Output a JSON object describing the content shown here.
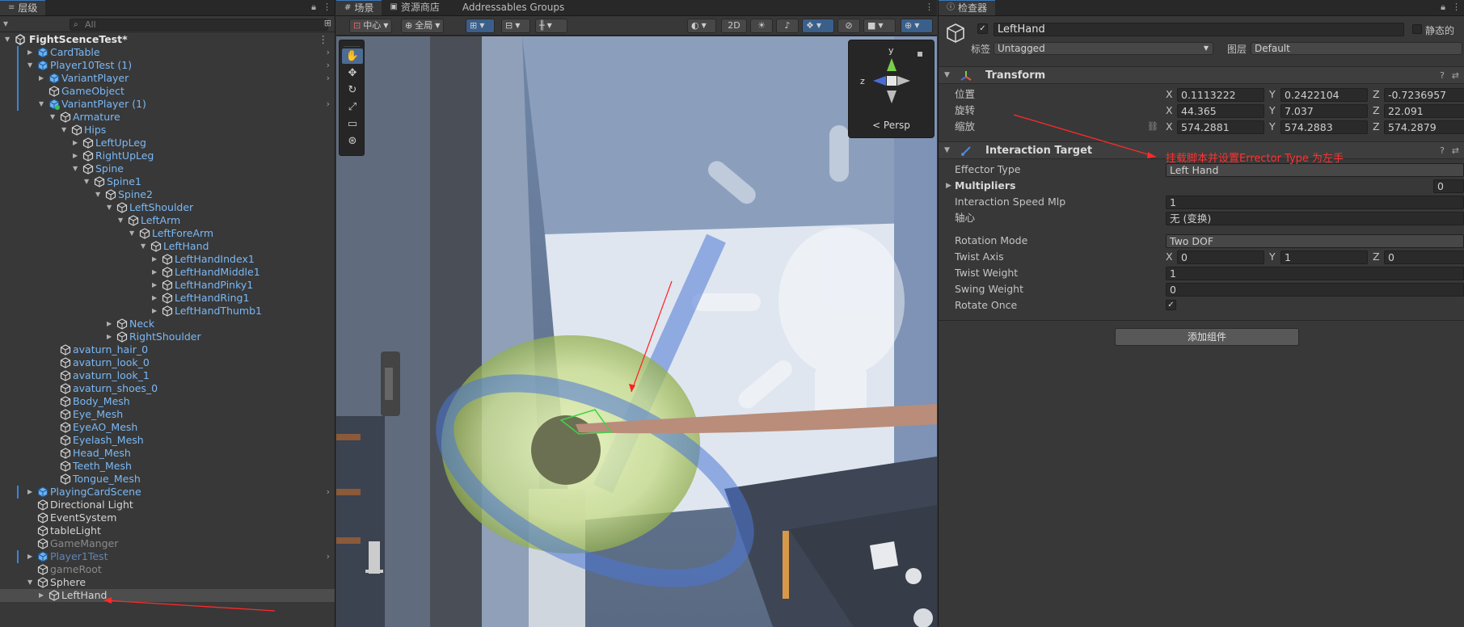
{
  "hierarchy": {
    "tab_label": "层级",
    "search_placeholder": "All",
    "scene_name": "FightScenceTest*",
    "rows": [
      {
        "label": "CardTable",
        "depth": 1,
        "exp": "right",
        "icon": "prefab",
        "color": "blue",
        "bar": true,
        "chev": true
      },
      {
        "label": "Player10Test (1)",
        "depth": 1,
        "exp": "down",
        "icon": "prefab",
        "color": "blue",
        "bar": true,
        "chev": true
      },
      {
        "label": "VariantPlayer",
        "depth": 2,
        "exp": "right",
        "icon": "prefab",
        "color": "blue",
        "bar": true,
        "chev": true
      },
      {
        "label": "GameObject",
        "depth": 2,
        "exp": "",
        "icon": "cube",
        "color": "blue",
        "bar": true
      },
      {
        "label": "VariantPlayer (1)",
        "depth": 2,
        "exp": "down",
        "icon": "variant",
        "color": "blue",
        "bar": true,
        "chev": true
      },
      {
        "label": "Armature",
        "depth": 3,
        "exp": "down",
        "icon": "cube",
        "color": "blue"
      },
      {
        "label": "Hips",
        "depth": 4,
        "exp": "down",
        "icon": "cube",
        "color": "blue"
      },
      {
        "label": "LeftUpLeg",
        "depth": 5,
        "exp": "right",
        "icon": "cube",
        "color": "blue"
      },
      {
        "label": "RightUpLeg",
        "depth": 5,
        "exp": "right",
        "icon": "cube",
        "color": "blue"
      },
      {
        "label": "Spine",
        "depth": 5,
        "exp": "down",
        "icon": "cube",
        "color": "blue"
      },
      {
        "label": "Spine1",
        "depth": 6,
        "exp": "down",
        "icon": "cube",
        "color": "blue"
      },
      {
        "label": "Spine2",
        "depth": 7,
        "exp": "down",
        "icon": "cube",
        "color": "blue"
      },
      {
        "label": "LeftShoulder",
        "depth": 8,
        "exp": "down",
        "icon": "cube",
        "color": "blue"
      },
      {
        "label": "LeftArm",
        "depth": 9,
        "exp": "down",
        "icon": "cube",
        "color": "blue"
      },
      {
        "label": "LeftForeArm",
        "depth": 10,
        "exp": "down",
        "icon": "cube",
        "color": "blue"
      },
      {
        "label": "LeftHand",
        "depth": 11,
        "exp": "down",
        "icon": "cube",
        "color": "blue"
      },
      {
        "label": "LeftHandIndex1",
        "depth": 12,
        "exp": "right",
        "icon": "cube",
        "color": "blue"
      },
      {
        "label": "LeftHandMiddle1",
        "depth": 12,
        "exp": "right",
        "icon": "cube",
        "color": "blue"
      },
      {
        "label": "LeftHandPinky1",
        "depth": 12,
        "exp": "right",
        "icon": "cube",
        "color": "blue"
      },
      {
        "label": "LeftHandRing1",
        "depth": 12,
        "exp": "right",
        "icon": "cube",
        "color": "blue"
      },
      {
        "label": "LeftHandThumb1",
        "depth": 12,
        "exp": "right",
        "icon": "cube",
        "color": "blue"
      },
      {
        "label": "Neck",
        "depth": 8,
        "exp": "right",
        "icon": "cube",
        "color": "blue"
      },
      {
        "label": "RightShoulder",
        "depth": 8,
        "exp": "right",
        "icon": "cube",
        "color": "blue"
      },
      {
        "label": "avaturn_hair_0",
        "depth": 3,
        "exp": "",
        "icon": "cube",
        "color": "blue"
      },
      {
        "label": "avaturn_look_0",
        "depth": 3,
        "exp": "",
        "icon": "cube",
        "color": "blue"
      },
      {
        "label": "avaturn_look_1",
        "depth": 3,
        "exp": "",
        "icon": "cube",
        "color": "blue"
      },
      {
        "label": "avaturn_shoes_0",
        "depth": 3,
        "exp": "",
        "icon": "cube",
        "color": "blue"
      },
      {
        "label": "Body_Mesh",
        "depth": 3,
        "exp": "",
        "icon": "cube",
        "color": "blue"
      },
      {
        "label": "Eye_Mesh",
        "depth": 3,
        "exp": "",
        "icon": "cube",
        "color": "blue"
      },
      {
        "label": "EyeAO_Mesh",
        "depth": 3,
        "exp": "",
        "icon": "cube",
        "color": "blue"
      },
      {
        "label": "Eyelash_Mesh",
        "depth": 3,
        "exp": "",
        "icon": "cube",
        "color": "blue"
      },
      {
        "label": "Head_Mesh",
        "depth": 3,
        "exp": "",
        "icon": "cube",
        "color": "blue"
      },
      {
        "label": "Teeth_Mesh",
        "depth": 3,
        "exp": "",
        "icon": "cube",
        "color": "blue"
      },
      {
        "label": "Tongue_Mesh",
        "depth": 3,
        "exp": "",
        "icon": "cube",
        "color": "blue"
      },
      {
        "label": "PlayingCardScene",
        "depth": 1,
        "exp": "right",
        "icon": "prefab",
        "color": "blue",
        "bar": true,
        "chev": true
      },
      {
        "label": "Directional Light",
        "depth": 1,
        "exp": "",
        "icon": "cube",
        "color": "norm"
      },
      {
        "label": "EventSystem",
        "depth": 1,
        "exp": "",
        "icon": "cube",
        "color": "norm"
      },
      {
        "label": "tableLight",
        "depth": 1,
        "exp": "",
        "icon": "cube",
        "color": "norm"
      },
      {
        "label": "GameManger",
        "depth": 1,
        "exp": "",
        "icon": "cube",
        "color": "dim"
      },
      {
        "label": "Player1Test",
        "depth": 1,
        "exp": "right",
        "icon": "prefab",
        "color": "fadeblue",
        "bar": true,
        "chev": true
      },
      {
        "label": "gameRoot",
        "depth": 1,
        "exp": "",
        "icon": "cube",
        "color": "dim"
      },
      {
        "label": "Sphere",
        "depth": 1,
        "exp": "down",
        "icon": "cube",
        "color": "norm"
      },
      {
        "label": "LeftHand",
        "depth": 2,
        "exp": "right",
        "icon": "cube",
        "color": "norm",
        "sel": true
      }
    ]
  },
  "scene": {
    "tabs": [
      {
        "label": "场景",
        "active": true
      },
      {
        "label": "资源商店",
        "active": false
      },
      {
        "label": "Addressables Groups",
        "active": false
      }
    ],
    "toolbar": {
      "pivot": "中心",
      "global": "全局",
      "mode2d": "2D"
    },
    "gizmo": {
      "y": "y",
      "z": "z",
      "persp": "< Persp"
    }
  },
  "inspector": {
    "tab_label": "检查器",
    "object_name": "LeftHand",
    "static_label": "静态的",
    "tag_label": "标签",
    "tag_value": "Untagged",
    "layer_label": "图层",
    "layer_value": "Default",
    "transform": {
      "title": "Transform",
      "position": {
        "label": "位置",
        "x": "0.1113222",
        "y": "0.2422104",
        "z": "-0.7236957"
      },
      "rotation": {
        "label": "旋转",
        "x": "44.365",
        "y": "7.037",
        "z": "22.091"
      },
      "scale": {
        "label": "缩放",
        "x": "574.2881",
        "y": "574.2883",
        "z": "574.2879"
      }
    },
    "interaction_target": {
      "title": "Interaction Target",
      "effector_type": {
        "label": "Effector Type",
        "value": "Left Hand"
      },
      "multipliers": {
        "label": "Multipliers",
        "value": "0"
      },
      "interaction_speed": {
        "label": "Interaction Speed Mlp",
        "value": "1"
      },
      "pivot": {
        "label": "轴心",
        "value": "无 (变换)"
      },
      "rotation_mode": {
        "label": "Rotation Mode",
        "value": "Two DOF"
      },
      "twist_axis": {
        "label": "Twist Axis",
        "x": "0",
        "y": "1",
        "z": "0"
      },
      "twist_weight": {
        "label": "Twist Weight",
        "value": "1"
      },
      "swing_weight": {
        "label": "Swing Weight",
        "value": "0"
      },
      "rotate_once": {
        "label": "Rotate Once",
        "checked": true
      }
    },
    "add_component": "添加组件"
  },
  "annotation": {
    "text": "挂载脚本并设置Errector Type 为左手"
  },
  "colors": {
    "accent": "#3a79bb",
    "annotation": "#ff3232",
    "prefab": "#6fb0ee"
  }
}
